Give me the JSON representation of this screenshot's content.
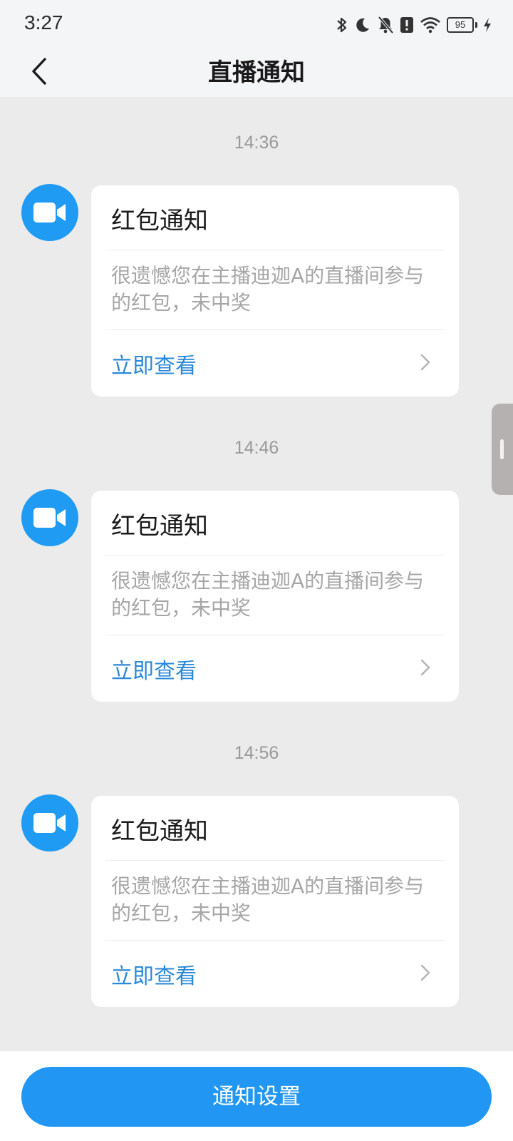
{
  "status_bar": {
    "time": "3:27",
    "battery_level": "95",
    "icons": [
      "bluetooth-icon",
      "moon-icon",
      "bell-off-icon",
      "alert-icon",
      "wifi-icon",
      "battery-icon",
      "charging-icon"
    ]
  },
  "header": {
    "title": "直播通知",
    "back_icon": "chevron-left-icon"
  },
  "messages": [
    {
      "time": "14:36",
      "title": "红包通知",
      "body": "很遗憾您在主播迪迦A的直播间参与的红包，未中奖",
      "action": "立即查看"
    },
    {
      "time": "14:46",
      "title": "红包通知",
      "body": "很遗憾您在主播迪迦A的直播间参与的红包，未中奖",
      "action": "立即查看"
    },
    {
      "time": "14:56",
      "title": "红包通知",
      "body": "很遗憾您在主播迪迦A的直播间参与的红包，未中奖",
      "action": "立即查看"
    }
  ],
  "footer": {
    "settings_label": "通知设置"
  },
  "colors": {
    "accent": "#2196f3",
    "avatar": "#1f9bf4",
    "link": "#2b88d8",
    "background": "#ebebeb"
  }
}
